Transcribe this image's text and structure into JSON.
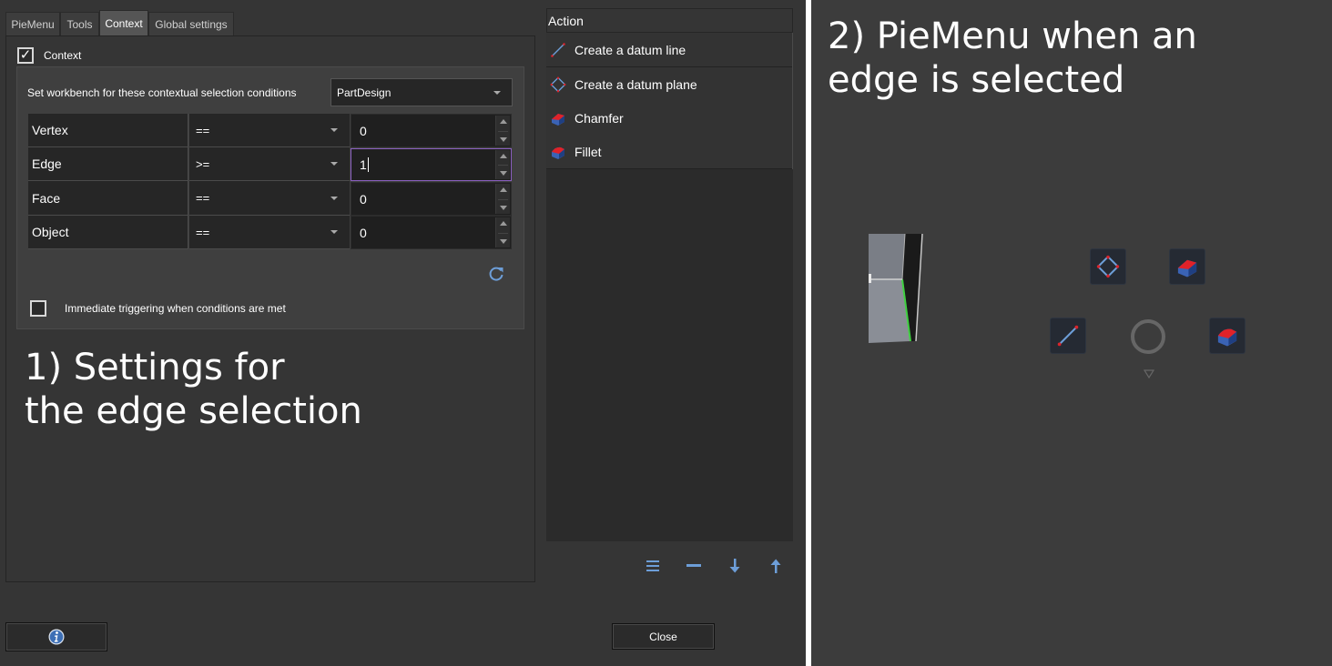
{
  "tabs": [
    {
      "label": "PieMenu",
      "active": false
    },
    {
      "label": "Tools",
      "active": false
    },
    {
      "label": "Context",
      "active": true
    },
    {
      "label": "Global settings",
      "active": false
    }
  ],
  "context": {
    "checkbox_label": "Context",
    "checked": true,
    "workbench_label": "Set workbench for these contextual selection conditions",
    "workbench_value": "PartDesign",
    "conditions": [
      {
        "name": "Vertex",
        "operator": "==",
        "value": "0"
      },
      {
        "name": "Edge",
        "operator": ">=",
        "value": "1"
      },
      {
        "name": "Face",
        "operator": "==",
        "value": "0"
      },
      {
        "name": "Object",
        "operator": "==",
        "value": "0"
      }
    ],
    "immediate_label": "Immediate triggering when conditions are met",
    "immediate_checked": false
  },
  "caption_left": "1) Settings for\nthe edge selection",
  "actions": {
    "header": "Action",
    "items": [
      {
        "label": "Create a datum line",
        "icon": "datum-line-icon"
      },
      {
        "label": "Create a datum plane",
        "icon": "datum-plane-icon"
      },
      {
        "label": "Chamfer",
        "icon": "chamfer-icon"
      },
      {
        "label": "Fillet",
        "icon": "fillet-icon"
      }
    ]
  },
  "toolbar_icons": [
    "list-icon",
    "remove-icon",
    "move-down-icon",
    "move-up-icon"
  ],
  "buttons": {
    "info_icon": "info-icon",
    "close": "Close"
  },
  "caption_right": "2) PieMenu when an\nedge is selected",
  "colors": {
    "accent_focus": "#8a5fc0",
    "icon_blue": "#6d9ed8",
    "icon_red": "#d9242b"
  }
}
